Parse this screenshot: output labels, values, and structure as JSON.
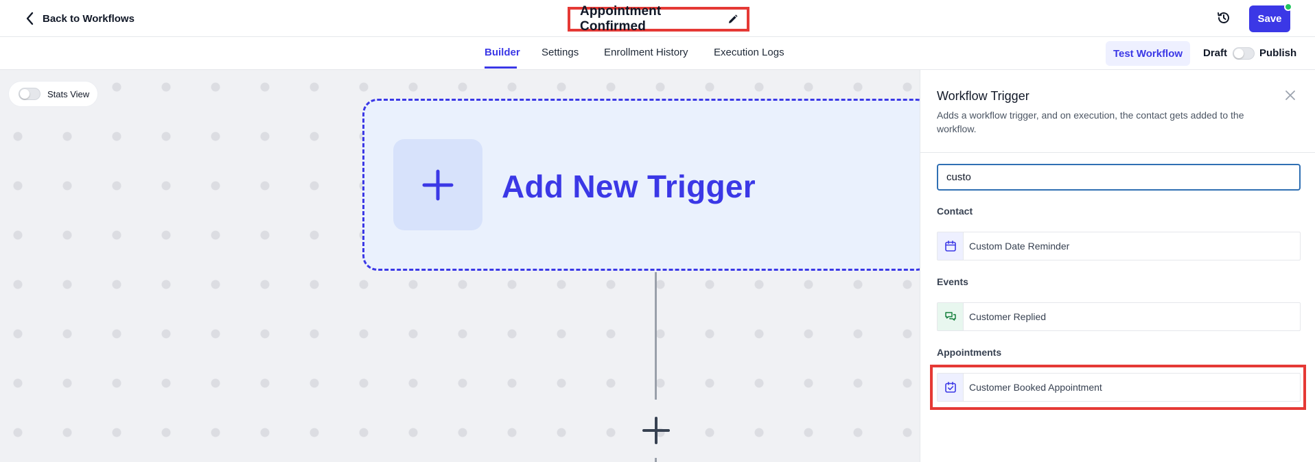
{
  "header": {
    "back_label": "Back to Workflows",
    "workflow_title": "Appointment Confirmed",
    "save_label": "Save"
  },
  "tabs": [
    {
      "label": "Builder",
      "active": true
    },
    {
      "label": "Settings",
      "active": false
    },
    {
      "label": "Enrollment History",
      "active": false
    },
    {
      "label": "Execution Logs",
      "active": false
    }
  ],
  "actions": {
    "test_workflow_label": "Test Workflow",
    "draft_label": "Draft",
    "publish_label": "Publish"
  },
  "canvas": {
    "stats_view_label": "Stats View",
    "trigger_label": "Add New Trigger"
  },
  "panel": {
    "title": "Workflow Trigger",
    "description": "Adds a workflow trigger, and on execution, the contact gets added to the workflow.",
    "search_value": "custo",
    "sections": [
      {
        "label": "Contact",
        "options": [
          {
            "label": "Custom Date Reminder",
            "icon": "calendar-icon"
          }
        ]
      },
      {
        "label": "Events",
        "options": [
          {
            "label": "Customer Replied",
            "icon": "chat-icon"
          }
        ]
      },
      {
        "label": "Appointments",
        "options": [
          {
            "label": "Customer Booked Appointment",
            "icon": "calendar-check-icon"
          }
        ]
      }
    ]
  },
  "colors": {
    "accent": "#3b38e6",
    "highlight": "#e53935",
    "status_dot": "#22c55e"
  }
}
